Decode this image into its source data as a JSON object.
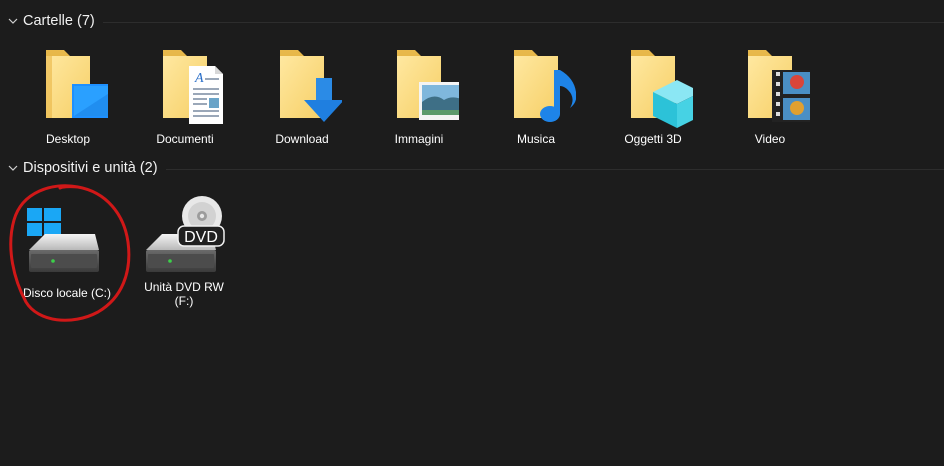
{
  "groups": [
    {
      "title": "Cartelle (7)",
      "items": [
        {
          "label": "Desktop",
          "icon": "folder-desktop-icon"
        },
        {
          "label": "Documenti",
          "icon": "folder-documents-icon"
        },
        {
          "label": "Download",
          "icon": "folder-download-icon"
        },
        {
          "label": "Immagini",
          "icon": "folder-pictures-icon"
        },
        {
          "label": "Musica",
          "icon": "folder-music-icon"
        },
        {
          "label": "Oggetti 3D",
          "icon": "folder-3d-objects-icon"
        },
        {
          "label": "Video",
          "icon": "folder-videos-icon"
        }
      ]
    },
    {
      "title": "Dispositivi e unità (2)",
      "items": [
        {
          "label": "Disco locale (C:)",
          "icon": "windows-drive-icon"
        },
        {
          "label": "Unità DVD RW (F:)",
          "icon": "dvd-drive-icon",
          "badge": "DVD"
        }
      ]
    }
  ],
  "annotation": {
    "color": "#d01818",
    "shape": "hand-drawn circle around Disco locale (C:)"
  }
}
